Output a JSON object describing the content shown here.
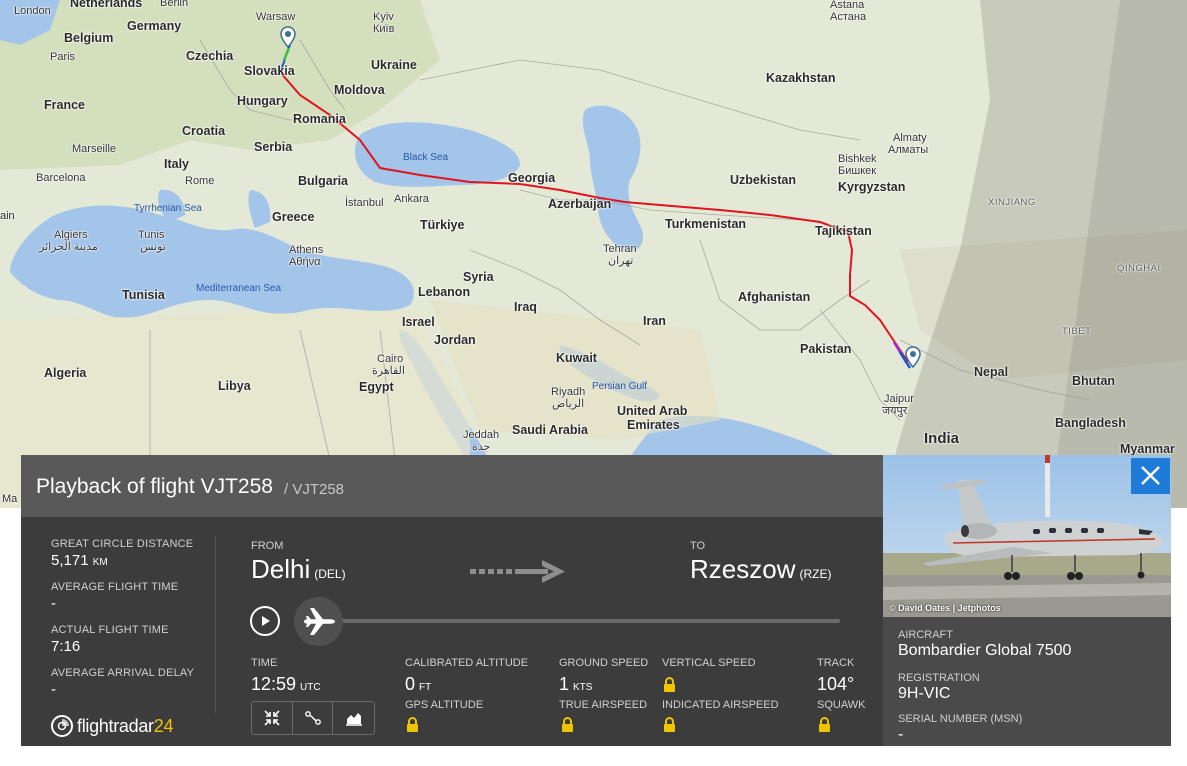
{
  "map": {
    "labels": {
      "london": "London",
      "netherlands": "Netherlands",
      "berlin": "Berlin",
      "germany": "Germany",
      "warsaw": "Warsaw",
      "belgium": "Belgium",
      "paris": "Paris",
      "czechia": "Czechia",
      "slovakia": "Slovakia",
      "hungary": "Hungary",
      "france": "France",
      "croatia": "Croatia",
      "romania": "Romania",
      "marseille": "Marseille",
      "serbia": "Serbia",
      "italy": "Italy",
      "rome": "Rome",
      "barcelona": "Barcelona",
      "bulgaria": "Bulgaria",
      "istanbul": "İstanbul",
      "ankara": "Ankara",
      "greece": "Greece",
      "turkiye": "Türkiye",
      "tyrrhenian_sea": "Tyrrhenian Sea",
      "athens": "Athens",
      "athens_local": "Αθήνα",
      "algiers": "Algiers",
      "algiers_local": "مدينة الجزائر",
      "tunis": "Tunis",
      "tunis_local": "تونس",
      "tunisia": "Tunisia",
      "mediterranean_sea": "Mediterranean Sea",
      "algeria": "Algeria",
      "libya": "Libya",
      "egypt": "Egypt",
      "cairo": "Cairo",
      "cairo_local": "القاهرة",
      "syria": "Syria",
      "lebanon": "Lebanon",
      "israel": "Israel",
      "jordan": "Jordan",
      "iraq": "Iraq",
      "kuwait": "Kuwait",
      "saudi_arabia": "Saudi Arabia",
      "riyadh": "Riyadh",
      "riyadh_local": "الرياض",
      "jeddah": "Jeddah",
      "jeddah_local": "جدة",
      "persian_gulf": "Persian Gulf",
      "uae_1": "United Arab",
      "uae_2": "Emirates",
      "iran": "Iran",
      "tehran": "Tehran",
      "tehran_local": "تهران",
      "kyiv": "Kyiv",
      "kyiv_local": "Київ",
      "ukraine": "Ukraine",
      "moldova": "Moldova",
      "black_sea": "Black Sea",
      "georgia": "Georgia",
      "azerbaijan": "Azerbaijan",
      "turkmenistan": "Turkmenistan",
      "uzbekistan": "Uzbekistan",
      "kazakhstan": "Kazakhstan",
      "astana": "Astana",
      "astana_local": "Астана",
      "almaty": "Almaty",
      "almaty_local": "Алматы",
      "bishkek": "Bishkek",
      "bishkek_local": "Бишкек",
      "kyrgyzstan": "Kyrgyzstan",
      "tajikistan": "Tajikistan",
      "xinjiang": "XINJIANG",
      "qinghai": "QINGHAI",
      "tibet": "TIBET",
      "afghanistan": "Afghanistan",
      "pakistan": "Pakistan",
      "nepal": "Nepal",
      "bhutan": "Bhutan",
      "bangladesh": "Bangladesh",
      "myanmar": "Myanmar",
      "india": "India",
      "jaipur": "Jaipur",
      "jaipur_local": "जयपुर",
      "edge_ma": "Ma",
      "edge_ain": "ain"
    }
  },
  "panel": {
    "title": "Playback of flight VJT258",
    "subtitle": "/ VJT258",
    "stats": {
      "great_circle_label": "GREAT CIRCLE DISTANCE",
      "great_circle_value": "5,171",
      "great_circle_unit": "KM",
      "avg_flight_time_label": "AVERAGE FLIGHT TIME",
      "avg_flight_time_value": "-",
      "actual_flight_time_label": "ACTUAL FLIGHT TIME",
      "actual_flight_time_value": "7:16",
      "avg_arrival_delay_label": "AVERAGE ARRIVAL DELAY",
      "avg_arrival_delay_value": "-"
    },
    "logo": {
      "text": "flightradar",
      "suffix": "24"
    },
    "route": {
      "from_label": "FROM",
      "from_city": "Delhi",
      "from_code": "(DEL)",
      "to_label": "TO",
      "to_city": "Rzeszow",
      "to_code": "(RZE)"
    },
    "playback": {
      "progress": 0
    },
    "metrics": {
      "time_label": "TIME",
      "time_value": "12:59",
      "time_unit": "UTC",
      "cal_alt_label": "CALIBRATED ALTITUDE",
      "cal_alt_value": "0",
      "cal_alt_unit": "FT",
      "gps_alt_label": "GPS ALTITUDE",
      "ground_speed_label": "GROUND SPEED",
      "ground_speed_value": "1",
      "ground_speed_unit": "KTS",
      "true_airspeed_label": "TRUE AIRSPEED",
      "vertical_speed_label": "VERTICAL SPEED",
      "indicated_airspeed_label": "INDICATED AIRSPEED",
      "track_label": "TRACK",
      "track_value": "104°",
      "squawk_label": "SQUAWK"
    }
  },
  "aircraft": {
    "photo_credit": "© David Oates | Jetphotos",
    "aircraft_label": "AIRCRAFT",
    "aircraft_value": "Bombardier Global 7500",
    "registration_label": "REGISTRATION",
    "registration_value": "9H-VIC",
    "serial_label": "SERIAL NUMBER (MSN)",
    "serial_value": "-"
  },
  "colors": {
    "flight_path": "#e0141e",
    "panel_bg": "#3c3c3c",
    "panel_header": "#595959",
    "close_button": "#1e7bd8",
    "logo_accent": "#f0c400",
    "map_water": "#a4c5ea"
  },
  "icons": {
    "play": "play-icon",
    "plane": "plane-icon",
    "lock": "lock-icon",
    "close": "close-icon",
    "map_pin": "map-pin-icon",
    "arrow": "route-arrow-icon",
    "view_shrink": "collapse-arrows-icon",
    "view_route": "route-nodes-icon",
    "view_chart": "area-chart-icon"
  }
}
